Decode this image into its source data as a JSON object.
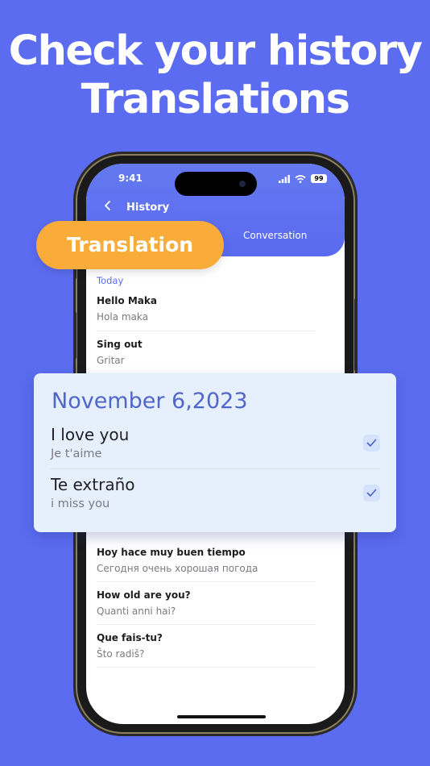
{
  "headline": {
    "line1": "Check your history",
    "line2": "Translations"
  },
  "status": {
    "time": "9:41",
    "battery": "99"
  },
  "header": {
    "title": "History",
    "tab_conversation": "Conversation"
  },
  "pill": {
    "label": "Translation"
  },
  "today": {
    "label": "Today",
    "items": [
      {
        "source": "Hello Maka",
        "translation": "Hola maka"
      },
      {
        "source": "Sing out",
        "translation": "Gritar"
      }
    ]
  },
  "card": {
    "date": "November 6,2023",
    "items": [
      {
        "source": "I love you",
        "translation": "Je t'aime",
        "checked": true
      },
      {
        "source": "Te extraño",
        "translation": "i miss you",
        "checked": true
      }
    ]
  },
  "more": {
    "items": [
      {
        "source": "Hoy hace muy buen tiempo",
        "translation": "Сегодня очень хорошая погода"
      },
      {
        "source": "How old are you?",
        "translation": "Quanti anni hai?"
      },
      {
        "source": "Que fais-tu?",
        "translation": "Što radiš?"
      }
    ]
  },
  "colors": {
    "background": "#5b6cf0",
    "accent": "#5b6cf0",
    "pill": "#f9ac3a",
    "card": "#e6effc"
  }
}
